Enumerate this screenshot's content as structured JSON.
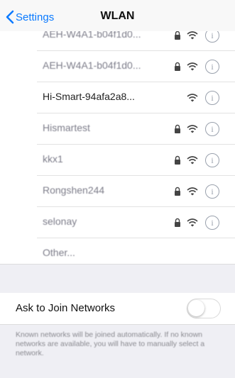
{
  "nav": {
    "back_label": "Settings",
    "title": "WLAN"
  },
  "networks": [
    {
      "name": "AEH-W4A1-b04f1d0...",
      "locked": true,
      "signal": "wifi"
    },
    {
      "name": "AEH-W4A1-b04f1d0...",
      "locked": true,
      "signal": "wifi"
    },
    {
      "name": "Hi-Smart-94afa2a8...",
      "locked": false,
      "signal": "wifi"
    },
    {
      "name": "Hismartest",
      "locked": true,
      "signal": "wifi"
    },
    {
      "name": "kkx1",
      "locked": true,
      "signal": "wifi"
    },
    {
      "name": "Rongshen244",
      "locked": true,
      "signal": "wifi"
    },
    {
      "name": "selonay",
      "locked": true,
      "signal": "wifi"
    }
  ],
  "other_label": "Other...",
  "info_glyph": "i",
  "ask_to_join": {
    "label": "Ask to Join Networks",
    "enabled": false
  },
  "footer_text": "Known networks will be joined automatically. If no known networks are available, you will have to manually select a network.",
  "colors": {
    "accent": "#0a7aff",
    "group_background": "#efeff4"
  }
}
